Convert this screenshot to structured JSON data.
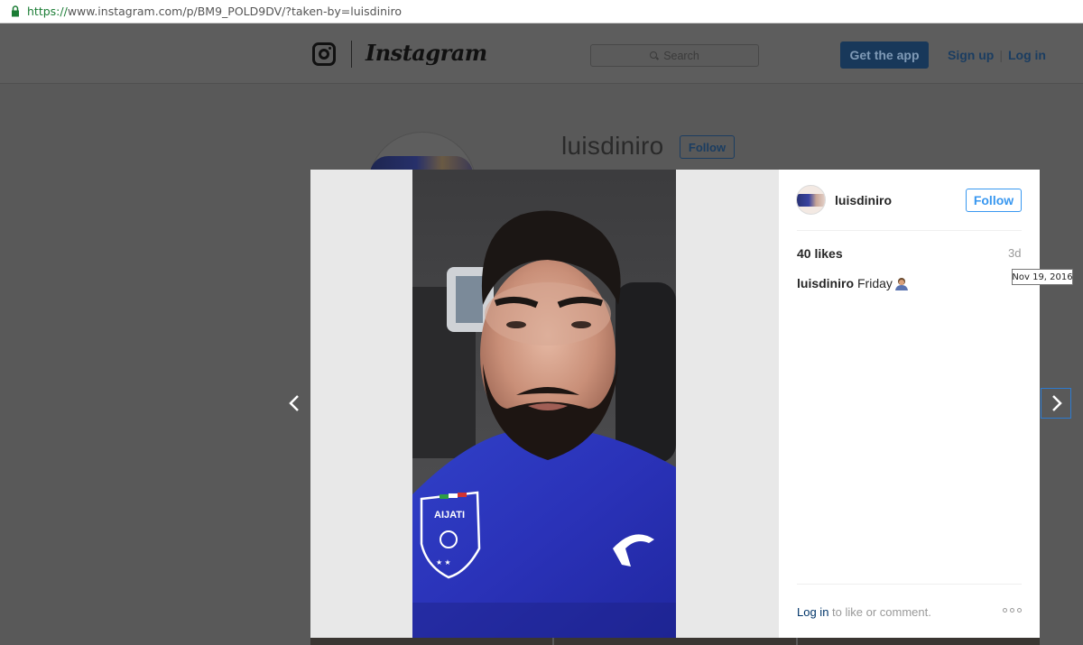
{
  "browser": {
    "url_scheme": "https://",
    "url_rest": "www.instagram.com/p/BM9_POLD9DV/?taken-by=luisdiniro"
  },
  "header": {
    "logo_text": "Instagram",
    "search_placeholder": "Search",
    "get_app_label": "Get the app",
    "sign_up_label": "Sign up",
    "divider": "|",
    "log_in_label": "Log in"
  },
  "profile": {
    "username": "luisdiniro",
    "follow_label": "Follow"
  },
  "post": {
    "username": "luisdiniro",
    "follow_label": "Follow",
    "likes": "40 likes",
    "time_ago": "3d",
    "time_tooltip": "Nov 19, 2016",
    "caption_user": "luisdiniro",
    "caption_text": "Friday",
    "login_link": "Log in",
    "login_suffix": " to like or comment.",
    "shirt_text": "AIJATI"
  },
  "icons": {
    "lock": "lock-icon",
    "camera": "instagram-camera-icon",
    "search": "search-icon",
    "prev": "chevron-left-icon",
    "next": "chevron-right-icon",
    "more": "more-options-icon",
    "emoji": "person-emoji-icon"
  },
  "colors": {
    "accent_blue": "#3897f0",
    "link_dark": "#003569",
    "overlay_bg": "#595959",
    "url_green": "#1b7d35"
  }
}
